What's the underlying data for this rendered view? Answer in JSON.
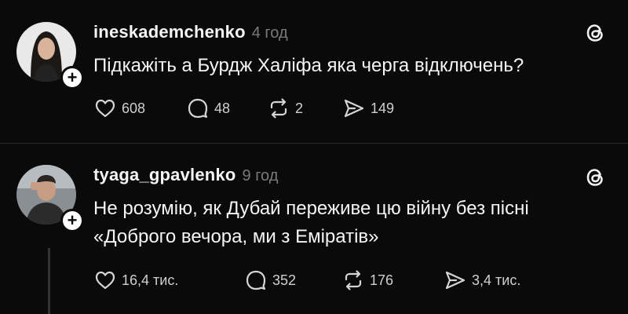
{
  "posts": [
    {
      "username": "ineskademchenko",
      "time": "4 год",
      "content_lines": [
        "Підкажіть а Бурдж Халіфа яка черга відключень?"
      ],
      "likes": "608",
      "comments": "48",
      "reposts": "2",
      "shares": "149"
    },
    {
      "username": "tyaga_gpavlenko",
      "time": "9 год",
      "content_lines": [
        "Не розумію, як Дубай переживе цю війну без пісні",
        "«Доброго вечора, ми з Еміратів»"
      ],
      "likes": "16,4 тис.",
      "comments": "352",
      "reposts": "176",
      "shares": "3,4 тис."
    }
  ],
  "follow_symbol": "+",
  "icons": {
    "like": "heart-icon",
    "comment": "comment-icon",
    "repost": "repost-icon",
    "share": "share-icon",
    "threads": "threads-logo-icon"
  },
  "colors": {
    "background": "#0a0a0a",
    "text": "#f5f5f5",
    "muted": "#7a7a7a"
  }
}
